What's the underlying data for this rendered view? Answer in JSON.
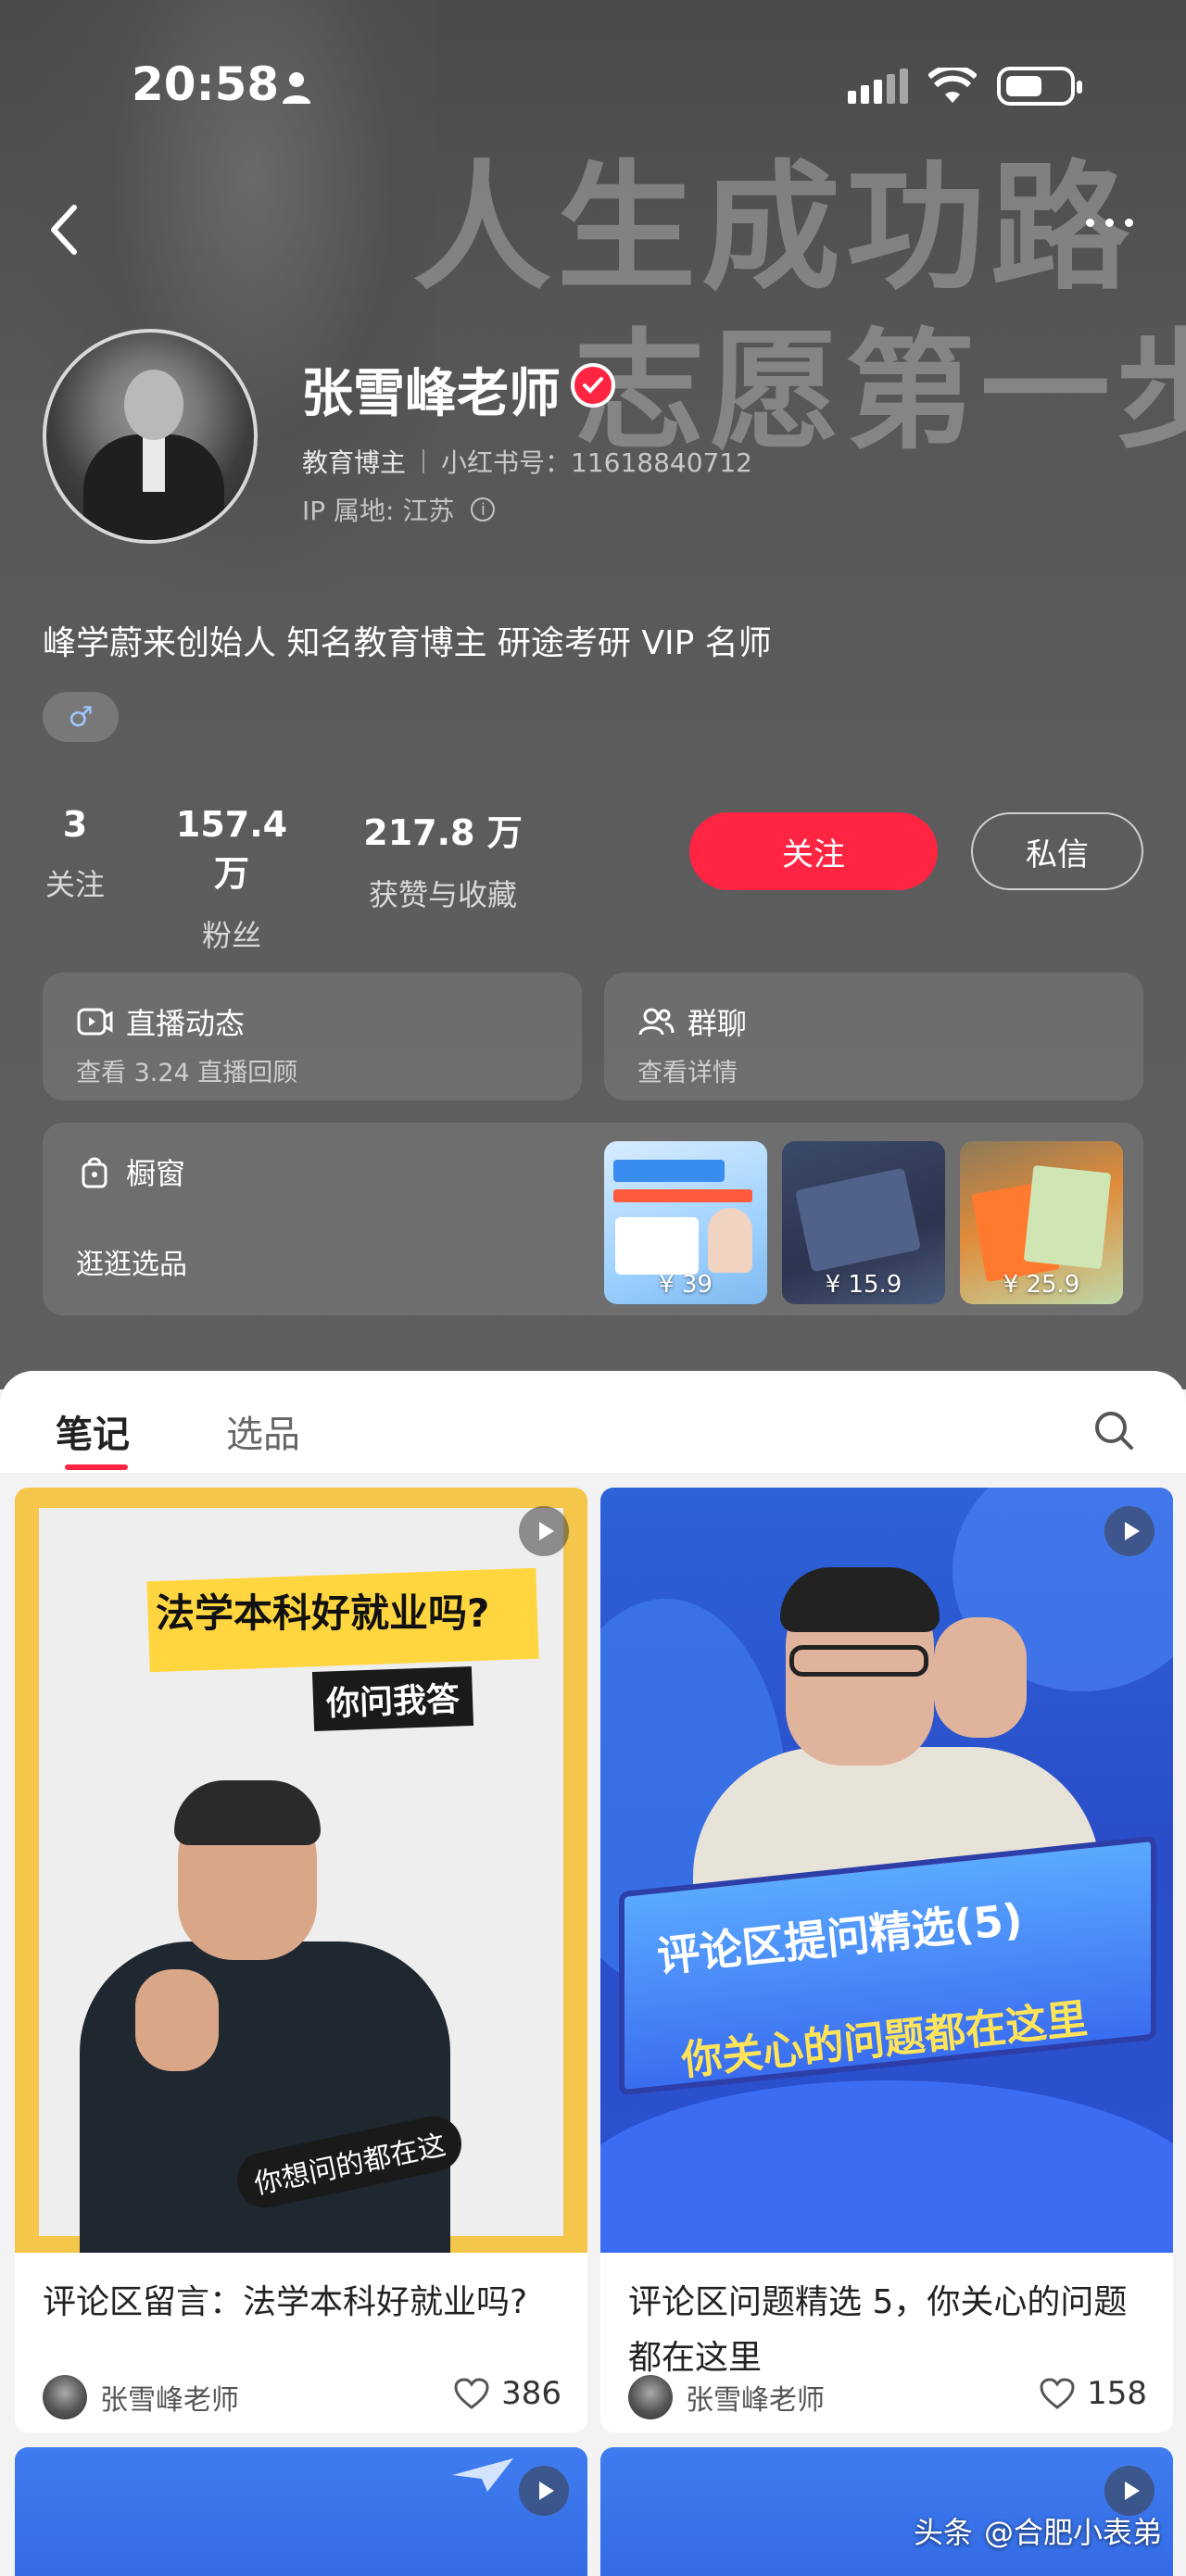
{
  "status_bar": {
    "time": "20:58",
    "person_icon": "person-icon",
    "signal_icon": "signal-icon",
    "wifi_icon": "wifi-icon",
    "battery_icon": "battery-icon"
  },
  "nav": {
    "back_icon": "chevron-left-icon",
    "more_icon": "more-dots-icon"
  },
  "banner_text": {
    "line1": "人生成功路",
    "line2": "志愿第一步"
  },
  "profile": {
    "name": "张雪峰老师",
    "verified_icon": "verified-badge-icon",
    "category": "教育博主",
    "red_id": "小红书号：11618840712",
    "ip": "IP 属地: 江苏",
    "bio": "峰学蔚来创始人 知名教育博主 研途考研 VIP 名师",
    "gender_symbol": "♂"
  },
  "stats": [
    {
      "num": "3",
      "label": "关注"
    },
    {
      "num": "157.4 万",
      "label": "粉丝"
    },
    {
      "num": "217.8 万",
      "label": "获赞与收藏"
    }
  ],
  "actions": {
    "follow": "关注",
    "message": "私信"
  },
  "cards": {
    "live": {
      "title": "直播动态",
      "sub": "查看 3.24 直播回顾"
    },
    "group": {
      "title": "群聊",
      "sub": "查看详情"
    },
    "shop": {
      "title": "橱窗",
      "sub": "逛逛选品",
      "products": [
        {
          "price": "¥ 39"
        },
        {
          "price": "¥ 15.9"
        },
        {
          "price": "¥ 25.9"
        }
      ]
    }
  },
  "tabs": [
    "笔记",
    "选品"
  ],
  "notes": [
    {
      "cover_heading": "法学本科好就业吗?",
      "cover_sub": "你问我答",
      "cover_tag": "你想问的都在这",
      "title": "评论区留言：法学本科好就业吗?",
      "author": "张雪峰老师",
      "likes": "386"
    },
    {
      "cover_heading": "评论区提问精选(5)",
      "cover_sub": "你关心的问题都在这里",
      "title": "评论区问题精选 5，你关心的问题都在这里",
      "author": "张雪峰老师",
      "likes": "158"
    }
  ],
  "watermark": {
    "source": "头条",
    "handle": "@合肥小表弟"
  },
  "colors": {
    "accent": "#ff2442",
    "header_bg": "#5a5a5a"
  }
}
